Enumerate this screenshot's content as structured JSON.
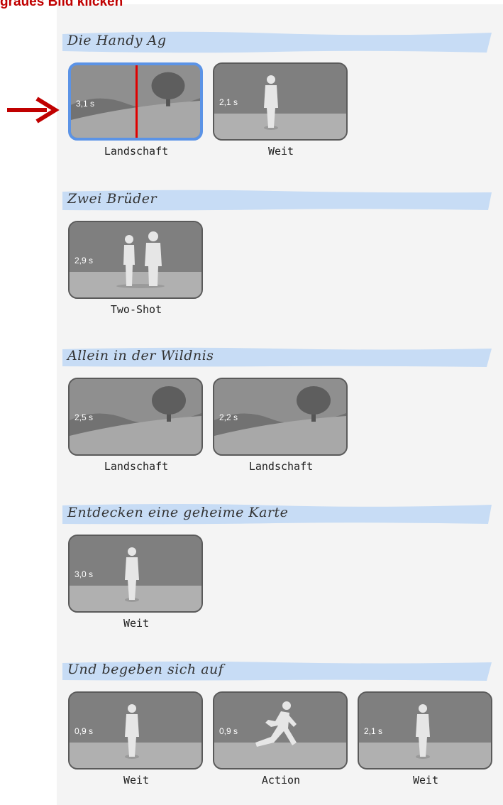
{
  "top_note": "graues Bild klicken",
  "colors": {
    "highlight": "#5b93e6",
    "playhead": "#e00000",
    "annotation": "#c00000",
    "band": "#c7dcf5"
  },
  "scenes": [
    {
      "title": "Die Handy Ag",
      "shots": [
        {
          "duration": "3,1 s",
          "label": "Landschaft",
          "icon": "landscape-tree-icon",
          "selected": true
        },
        {
          "duration": "2,1 s",
          "label": "Weit",
          "icon": "standing-person-icon"
        }
      ]
    },
    {
      "title": "Zwei Brüder",
      "shots": [
        {
          "duration": "2,9 s",
          "label": "Two-Shot",
          "icon": "two-people-icon"
        }
      ]
    },
    {
      "title": "Allein in der Wildnis",
      "shots": [
        {
          "duration": "2,5 s",
          "label": "Landschaft",
          "icon": "landscape-tree-icon"
        },
        {
          "duration": "2,2 s",
          "label": "Landschaft",
          "icon": "landscape-tree-icon"
        }
      ]
    },
    {
      "title": "Entdecken eine geheime Karte",
      "shots": [
        {
          "duration": "3,0 s",
          "label": "Weit",
          "icon": "standing-person-icon"
        }
      ]
    },
    {
      "title": "Und begeben sich auf",
      "shots": [
        {
          "duration": "0,9 s",
          "label": "Weit",
          "icon": "standing-person-icon"
        },
        {
          "duration": "0,9 s",
          "label": "Action",
          "icon": "running-person-icon"
        },
        {
          "duration": "2,1 s",
          "label": "Weit",
          "icon": "standing-person-icon"
        }
      ]
    }
  ]
}
